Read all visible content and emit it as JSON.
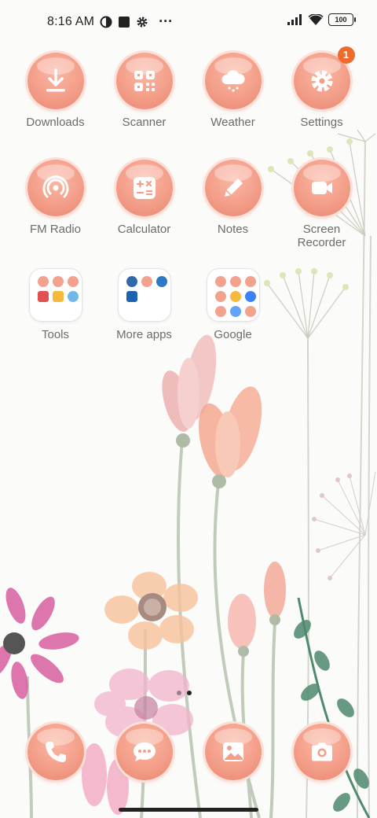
{
  "status_bar": {
    "time": "8:16 AM",
    "more": "···",
    "battery": "100",
    "icons": [
      "data-saver-icon",
      "stop-square-icon",
      "gear-icon",
      "signal-icon",
      "wifi-icon",
      "battery-icon"
    ]
  },
  "apps": [
    {
      "label": "Downloads",
      "icon": "download-icon"
    },
    {
      "label": "Scanner",
      "icon": "qr-scan-icon"
    },
    {
      "label": "Weather",
      "icon": "cloud-rain-icon"
    },
    {
      "label": "Settings",
      "icon": "gear-icon",
      "badge": "1"
    },
    {
      "label": "FM Radio",
      "icon": "radio-waves-icon"
    },
    {
      "label": "Calculator",
      "icon": "calculator-icon"
    },
    {
      "label": "Notes",
      "icon": "pencil-icon"
    },
    {
      "label": "Screen\nRecorder",
      "icon": "video-camera-icon"
    }
  ],
  "folders": [
    {
      "label": "Tools",
      "minis": [
        "#f3a28e",
        "#f3a28e",
        "#f3a28e",
        "#e2504f",
        "#f7b93c",
        "#6fb8e8"
      ]
    },
    {
      "label": "More apps",
      "minis": [
        "#2f6aa8",
        "#f3a28e",
        "#2c78c4",
        "#1d63b0"
      ]
    },
    {
      "label": "Google",
      "minis": [
        "#f3a28e",
        "#f3a28e",
        "#f3a28e",
        "#f3a28e",
        "#f7b93c",
        "#3b82f6",
        "#f3a28e",
        "#60a5fa",
        "#f3a28e"
      ]
    }
  ],
  "dock": [
    {
      "name": "phone",
      "icon": "phone-icon"
    },
    {
      "name": "messages",
      "icon": "chat-bubble-icon"
    },
    {
      "name": "gallery",
      "icon": "image-icon"
    },
    {
      "name": "camera",
      "icon": "camera-icon"
    }
  ],
  "colors": {
    "icon_bg": "#f39e89",
    "icon_ring": "#fbe0d8",
    "badge": "#f06a2c",
    "label": "#6c6c6c"
  }
}
